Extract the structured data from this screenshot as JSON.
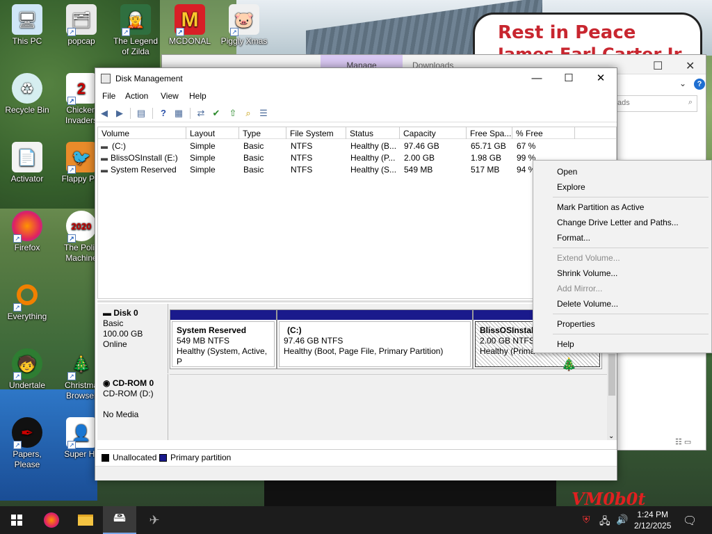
{
  "desktop": {
    "sign_line1": "Rest in Peace",
    "sign_line2": "James Earl Carter Jr.",
    "watermark": "VM0b0t",
    "icons": [
      {
        "label": "This PC"
      },
      {
        "label": "popcap"
      },
      {
        "label": "The Legend of Zilda"
      },
      {
        "label": "MCDONAL"
      },
      {
        "label": "Piggly Xmas"
      },
      {
        "label": "Recycle Bin"
      },
      {
        "label": "Chicken Invaders"
      },
      {
        "label": "Activator"
      },
      {
        "label": "Flappy Pla"
      },
      {
        "label": "Firefox"
      },
      {
        "label": "The Politi Machine"
      },
      {
        "label": "Everything"
      },
      {
        "label": "Undertale"
      },
      {
        "label": "Christma Browser"
      },
      {
        "label": "Papers, Please"
      },
      {
        "label": "Super Hil"
      }
    ]
  },
  "explorer": {
    "tab_manage": "Manage",
    "tab_downloads": "Downloads",
    "search_placeholder": "ads",
    "help": "?"
  },
  "window": {
    "title": "Disk Management",
    "menu": [
      "File",
      "Action",
      "View",
      "Help"
    ]
  },
  "volume_table": {
    "headers": [
      "Volume",
      "Layout",
      "Type",
      "File System",
      "Status",
      "Capacity",
      "Free Spa...",
      "% Free"
    ],
    "rows": [
      [
        "(C:)",
        "Simple",
        "Basic",
        "NTFS",
        "Healthy (B...",
        "97.46 GB",
        "65.71 GB",
        "67 %"
      ],
      [
        "BlissOSInstall (E:)",
        "Simple",
        "Basic",
        "NTFS",
        "Healthy (P...",
        "2.00 GB",
        "1.98 GB",
        "99 %"
      ],
      [
        "System Reserved",
        "Simple",
        "Basic",
        "NTFS",
        "Healthy (S...",
        "549 MB",
        "517 MB",
        "94 %"
      ]
    ]
  },
  "disk0": {
    "name": "Disk 0",
    "type": "Basic",
    "size": "100.00 GB",
    "state": "Online",
    "partitions": [
      {
        "name": "System Reserved",
        "size": "549 MB NTFS",
        "status": "Healthy (System, Active, P"
      },
      {
        "name": "(C:)",
        "size": "97.46 GB NTFS",
        "status": "Healthy (Boot, Page File, Primary Partition)"
      },
      {
        "name": "BlissOSInstall",
        "size": "2.00 GB NTFS",
        "status": "Healthy (Prima"
      }
    ]
  },
  "cdrom0": {
    "name": "CD-ROM 0",
    "drive": "CD-ROM (D:)",
    "media": "No Media"
  },
  "legend": {
    "unallocated": "Unallocated",
    "primary": "Primary partition"
  },
  "context_menu": {
    "open": "Open",
    "explore": "Explore",
    "mark_active": "Mark Partition as Active",
    "change_letter": "Change Drive Letter and Paths...",
    "format": "Format...",
    "extend": "Extend Volume...",
    "shrink": "Shrink Volume...",
    "add_mirror": "Add Mirror...",
    "delete": "Delete Volume...",
    "properties": "Properties",
    "help": "Help"
  },
  "taskbar": {
    "time": "1:24 PM",
    "date": "2/12/2025"
  }
}
